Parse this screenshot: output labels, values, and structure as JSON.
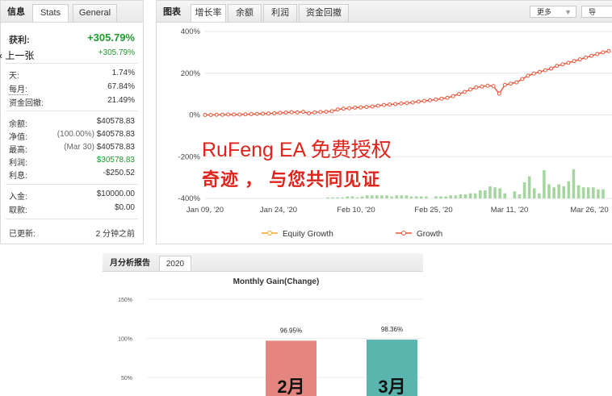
{
  "stats_tabs": {
    "info": "信息",
    "stats": "Stats",
    "general": "General"
  },
  "prev_link": "上一张",
  "profit": {
    "label": "获利:",
    "value": "+305.79%",
    "secondary": "+305.79%"
  },
  "periods": [
    {
      "label": "天:",
      "value": "1.74%"
    },
    {
      "label": "每月:",
      "value": "67.84%"
    },
    {
      "label": "资金回撤:",
      "value": "21.49%"
    }
  ],
  "balance": [
    {
      "label": "余额:",
      "value": "$40578.83",
      "note": ""
    },
    {
      "label": "净值:",
      "value": "$40578.83",
      "note": "(100.00%)"
    },
    {
      "label": "最高:",
      "value": "$40578.83",
      "note": "(Mar 30)"
    },
    {
      "label": "利润:",
      "value": "$30578.83",
      "note": ""
    },
    {
      "label": "利息:",
      "value": "-$250.52",
      "note": ""
    }
  ],
  "deposits": [
    {
      "label": "入金:",
      "value": "$10000.00"
    },
    {
      "label": "取款:",
      "value": "$0.00"
    }
  ],
  "updated": {
    "label": "已更新:",
    "value": "2 分钟之前"
  },
  "chart_tabs": {
    "title": "图表",
    "tabs": [
      "增长率",
      "余额",
      "利润",
      "资金回撤"
    ]
  },
  "chart_controls": {
    "more": "更多",
    "select2": "导"
  },
  "overlay_text": {
    "line1": "RuFeng EA 免费授权",
    "line2": "奇迹 ， 与您共同见证"
  },
  "colors": {
    "growth": "#e8563a",
    "equity": "#f5a623",
    "bars": "#a5d6a0",
    "bar_feb": "#e4857f",
    "bar_mar": "#5ab5af",
    "overlay": "#e0231b"
  },
  "chart_data": [
    {
      "type": "line",
      "title": "",
      "xlabel": "",
      "ylabel": "",
      "ylim": [
        -400,
        400
      ],
      "y_ticks": [
        "400%",
        "200%",
        "0%",
        "-200%",
        "-400%"
      ],
      "x_ticks": [
        "Jan 09, '20",
        "Jan 24, '20",
        "Feb 10, '20",
        "Feb 25, '20",
        "Mar 11, '20",
        "Mar 26, '20"
      ],
      "legend": "bottom",
      "series": [
        {
          "name": "Equity Growth",
          "values": []
        },
        {
          "name": "Growth",
          "values": [
            0,
            0,
            1,
            1,
            2,
            2,
            2,
            3,
            4,
            5,
            6,
            7,
            8,
            10,
            11,
            13,
            12,
            15,
            8,
            12,
            14,
            15,
            18,
            26,
            30,
            32,
            35,
            36,
            38,
            40,
            44,
            48,
            50,
            52,
            55,
            57,
            60,
            64,
            67,
            70,
            74,
            78,
            82,
            90,
            100,
            110,
            122,
            132,
            136,
            140,
            138,
            102,
            144,
            150,
            156,
            172,
            188,
            198,
            206,
            214,
            222,
            235,
            242,
            250,
            258,
            266,
            275,
            283,
            292,
            300,
            305.79
          ]
        }
      ],
      "bars": [
        0,
        0,
        0,
        0,
        0,
        0,
        0,
        0,
        0,
        0,
        0,
        1,
        1,
        1,
        1,
        2,
        2,
        1,
        2,
        3,
        3,
        3,
        3,
        3,
        2,
        3,
        3,
        3,
        2,
        2,
        2,
        2,
        0,
        2,
        2,
        2,
        3,
        3,
        4,
        4,
        5,
        5,
        8,
        8,
        12,
        11,
        10,
        5,
        0,
        7,
        4,
        16,
        22,
        10,
        5,
        28,
        14,
        11,
        14,
        12,
        17,
        29,
        13,
        11,
        11,
        11,
        9,
        9
      ]
    },
    {
      "type": "bar",
      "title": "Monthly Gain(Change)",
      "categories": [
        "2月",
        "3月"
      ],
      "values": [
        96.95,
        98.36
      ],
      "value_labels": [
        "96.95%",
        "98.36%"
      ],
      "y_ticks": [
        "150%",
        "100%",
        "50%"
      ],
      "ylim": [
        0,
        150
      ]
    }
  ],
  "monthly_tabs": {
    "title": "月分析报告",
    "year": "2020"
  }
}
